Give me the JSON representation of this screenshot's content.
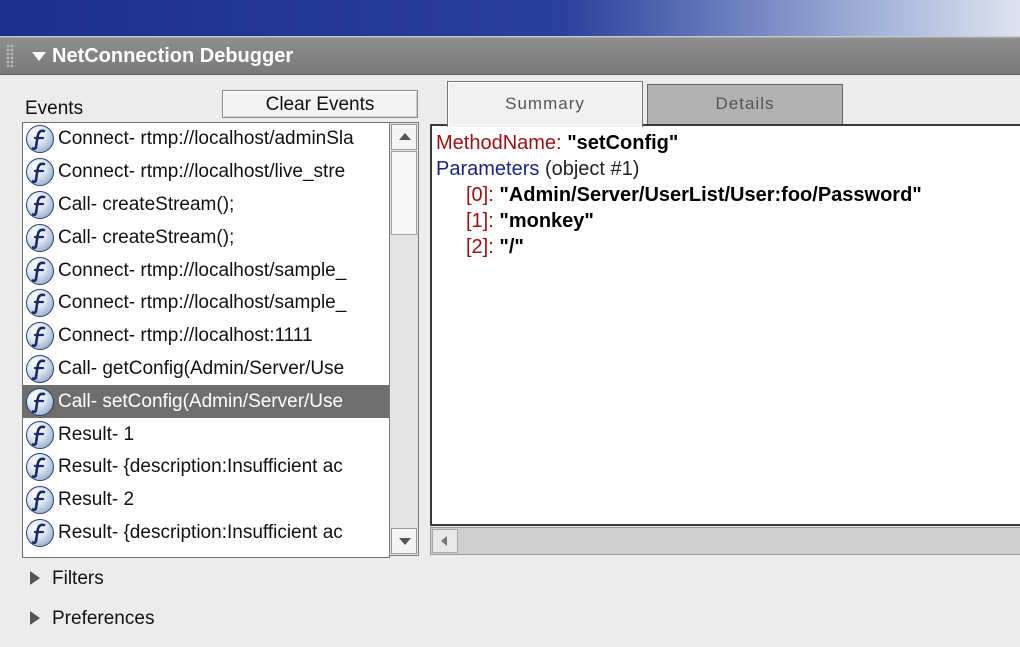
{
  "panel": {
    "title": "NetConnection Debugger"
  },
  "events": {
    "label": "Events",
    "clear_button": "Clear Events",
    "items": [
      "Connect- rtmp://localhost/adminSla",
      "Connect- rtmp://localhost/live_stre",
      "Call- createStream();",
      "Call- createStream();",
      "Connect- rtmp://localhost/sample_",
      "Connect- rtmp://localhost/sample_",
      "Connect- rtmp://localhost:1111",
      "Call- getConfig(Admin/Server/Use",
      "Call- setConfig(Admin/Server/Use",
      "Result- 1",
      "Result- {description:Insufficient ac",
      "Result- 2",
      "Result- {description:Insufficient ac"
    ],
    "selected_index": 8,
    "item_icon": "flash-player-icon"
  },
  "tabs": {
    "summary": "Summary",
    "details": "Details",
    "active": "Summary"
  },
  "summary": {
    "method_label": "MethodName:",
    "method_value": "\"setConfig\"",
    "params_label": "Parameters",
    "params_type": "(object #1)",
    "params": [
      {
        "key": "[0]:",
        "value": "\"Admin/Server/UserList/User:foo/Password\""
      },
      {
        "key": "[1]:",
        "value": "\"monkey\""
      },
      {
        "key": "[2]:",
        "value": "\"/\""
      }
    ]
  },
  "sections": {
    "filters": "Filters",
    "preferences": "Preferences"
  },
  "colors": {
    "title_bar": "#1c2f8e",
    "header_bar": "#808080",
    "selection": "#6e6e6e",
    "key_red": "#9a1010",
    "param_blue": "#1c2480"
  }
}
